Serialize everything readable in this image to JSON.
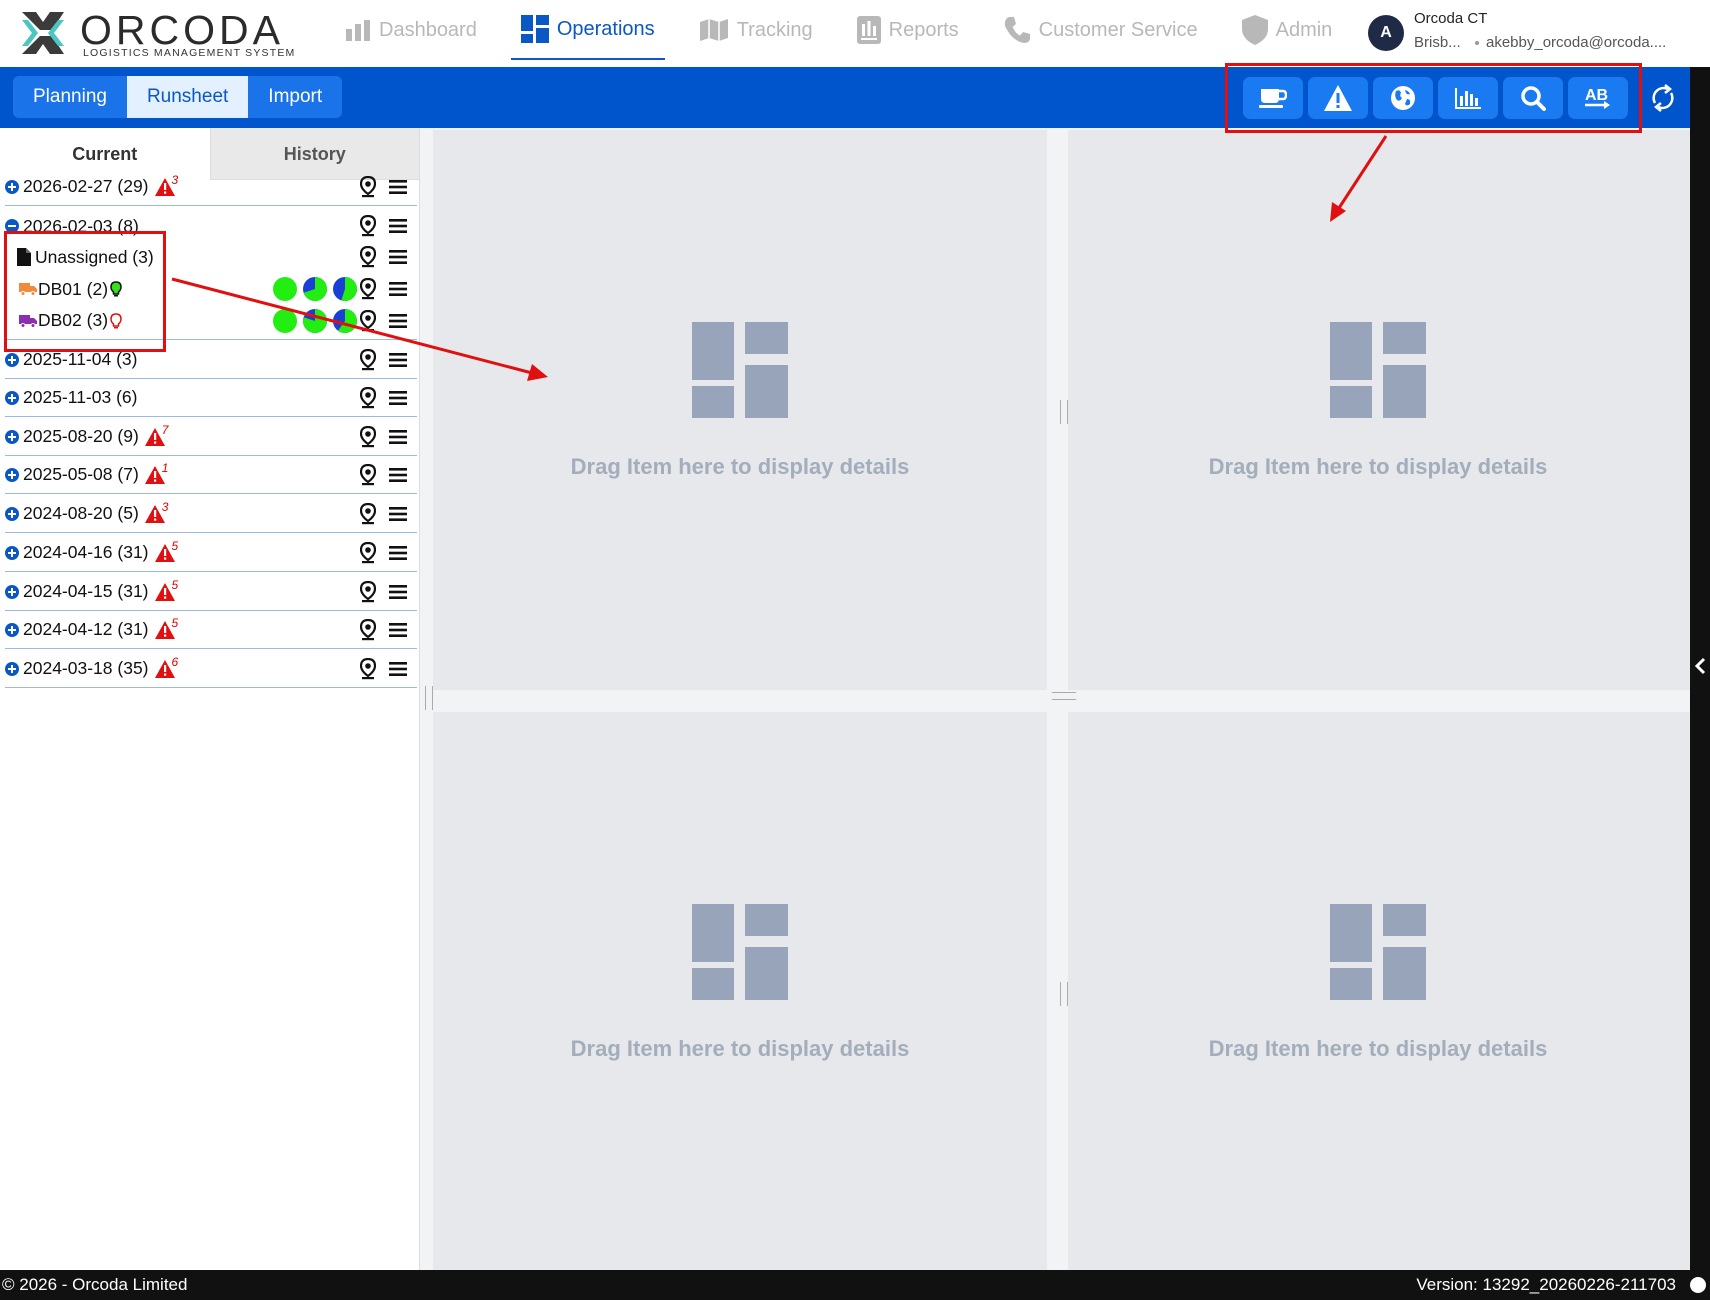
{
  "brand": {
    "title": "ORCODA",
    "subtitle": "LOGISTICS MANAGEMENT SYSTEM"
  },
  "nav": [
    {
      "label": "Dashboard",
      "icon": "bar-chart-icon",
      "active": false
    },
    {
      "label": "Operations",
      "icon": "dashboard-grid-icon",
      "active": true
    },
    {
      "label": "Tracking",
      "icon": "map-icon",
      "active": false
    },
    {
      "label": "Reports",
      "icon": "report-icon",
      "active": false
    },
    {
      "label": "Customer Service",
      "icon": "phone-icon",
      "active": false
    },
    {
      "label": "Admin",
      "icon": "shield-icon",
      "active": false
    }
  ],
  "user": {
    "initial": "A",
    "name": "Orcoda CT",
    "location": "Brisb...",
    "email": "akebby_orcoda@orcoda...."
  },
  "mode_tabs": [
    {
      "label": "Planning",
      "active": false
    },
    {
      "label": "Runsheet",
      "active": true
    },
    {
      "label": "Import",
      "active": false
    }
  ],
  "tools": [
    "coffee-cup-icon",
    "warning-icon",
    "globe-icon",
    "bar-chart-icon",
    "search-icon",
    "ab-transfer-icon"
  ],
  "side_tabs": {
    "current": "Current",
    "history": "History"
  },
  "tree": [
    {
      "label": "2026-02-27 (29)",
      "alerts": "3",
      "type": "date"
    },
    {
      "label": "2026-02-03 (8)",
      "alerts": "",
      "type": "date-open"
    },
    {
      "label": "Unassigned (3)",
      "type": "child-doc"
    },
    {
      "label": "DB01 (2)",
      "type": "child-truck",
      "truck_color": "#f08a3c",
      "bulb": "green"
    },
    {
      "label": "DB02 (3)",
      "type": "child-truck",
      "truck_color": "#8b2fb0",
      "bulb": "red"
    },
    {
      "label": "2025-11-04 (3)",
      "alerts": "",
      "type": "date"
    },
    {
      "label": "2025-11-03 (6)",
      "alerts": "",
      "type": "date"
    },
    {
      "label": "2025-08-20 (9)",
      "alerts": "7",
      "type": "date"
    },
    {
      "label": "2025-05-08 (7)",
      "alerts": "1",
      "type": "date"
    },
    {
      "label": "2024-08-20 (5)",
      "alerts": "3",
      "type": "date"
    },
    {
      "label": "2024-04-16 (31)",
      "alerts": "5",
      "type": "date"
    },
    {
      "label": "2024-04-15 (31)",
      "alerts": "5",
      "type": "date"
    },
    {
      "label": "2024-04-12 (31)",
      "alerts": "5",
      "type": "date"
    },
    {
      "label": "2024-03-18 (35)",
      "alerts": "6",
      "type": "date"
    }
  ],
  "panes": {
    "placeholder": "Drag Item here to display details"
  },
  "footer": {
    "copyright": "© 2026 - Orcoda Limited",
    "version": "Version: 13292_20260226-211703"
  },
  "colors": {
    "primary": "#0055cc",
    "alert": "#e01010",
    "pie_green": "#22ee11",
    "pie_blue": "#1a3fd6"
  }
}
